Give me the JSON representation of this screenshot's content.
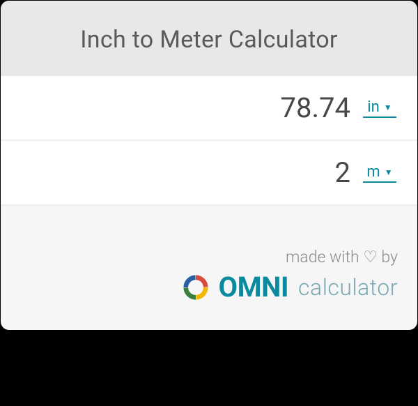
{
  "header": {
    "title": "Inch to Meter Calculator"
  },
  "rows": [
    {
      "value": "78.74",
      "unit": "in"
    },
    {
      "value": "2",
      "unit": "m"
    }
  ],
  "footer": {
    "made_with": "made with ♡ by",
    "brand_main": "OMNI",
    "brand_sub": "calculator"
  }
}
